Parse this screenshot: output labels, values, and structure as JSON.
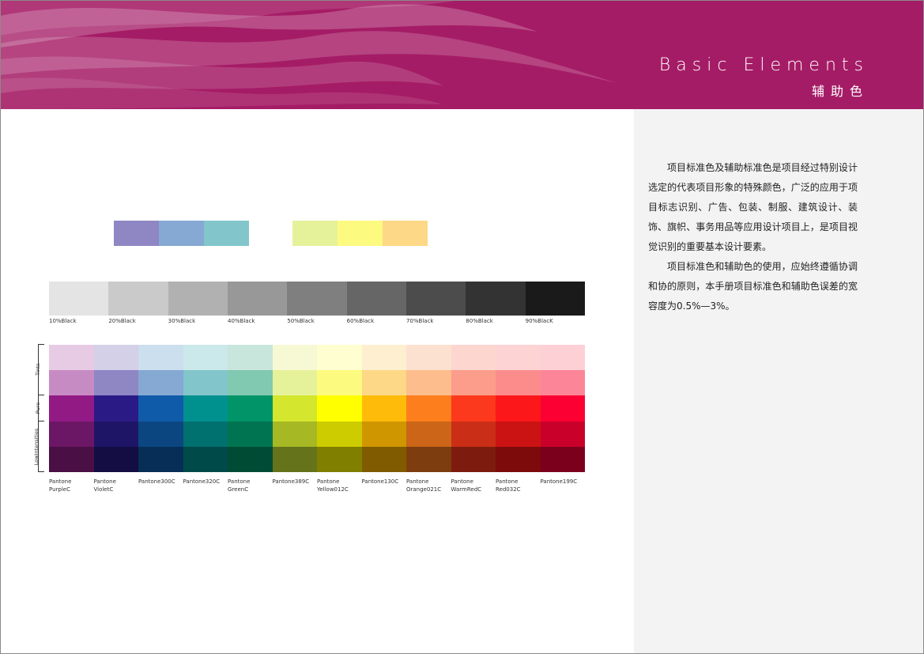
{
  "header": {
    "title_en": "Basic Elements",
    "title_zh": "辅助色",
    "color": "#a51c66"
  },
  "description": {
    "paragraphs": [
      "项目标准色及辅助标准色是项目经过特别设计选定的代表项目形象的特殊颜色，广泛的应用于项目标志识别、广告、包装、制服、建筑设计、装饰、旗帜、事务用品等应用设计项目上，是项目视觉识别的重要基本设计要素。",
      "项目标准色和辅助色的使用，应始终遵循协调和协的原则，本手册项目标准色和辅助色误差的宽容度为0.5%—3%。"
    ]
  },
  "accent_swatches": {
    "cool": [
      "#8e87c4",
      "#86a9d3",
      "#82c6cb"
    ],
    "warm": [
      "#e6f29a",
      "#fdfa80",
      "#fdd886"
    ]
  },
  "gray_scale": {
    "colors": [
      "#e4e4e4",
      "#cacaca",
      "#b1b1b1",
      "#989898",
      "#7f7f7f",
      "#666666",
      "#4c4c4c",
      "#333333",
      "#1a1a1a"
    ],
    "labels": [
      "10%Black",
      "20%Black",
      "30%Black",
      "40%Black",
      "50%Black",
      "60%Black",
      "70%Black",
      "80%Black",
      "90%BlacK"
    ]
  },
  "color_matrix": {
    "group_labels": [
      "Tints",
      "Pure",
      "LowIntensities"
    ],
    "rows": [
      [
        "#e7cbe4",
        "#d3d0e8",
        "#ccdfee",
        "#cbe8ea",
        "#c9e6dd",
        "#f6f9d3",
        "#fefed0",
        "#fdefcf",
        "#fde1d0",
        "#fdd6d0",
        "#fdd3d3",
        "#fdd0d6"
      ],
      [
        "#c78bc4",
        "#8e87c4",
        "#86a9d3",
        "#82c6cb",
        "#81c9b1",
        "#e6f29a",
        "#fdfa80",
        "#fdd886",
        "#fdbd8c",
        "#fc9c8a",
        "#fc8c8c",
        "#fc8598"
      ],
      [
        "#921a85",
        "#2a1a86",
        "#0f5baa",
        "#00918f",
        "#019468",
        "#d4e62d",
        "#ffff00",
        "#ffbb0a",
        "#fd7e1c",
        "#fc391c",
        "#fc171b",
        "#fc0033"
      ],
      [
        "#6c1765",
        "#1f1567",
        "#0b4681",
        "#00716f",
        "#007450",
        "#a6b824",
        "#cdcc00",
        "#cf9600",
        "#cc6517",
        "#cb2e17",
        "#cb1313",
        "#c8002a"
      ],
      [
        "#4a0f45",
        "#140d44",
        "#062e56",
        "#004a49",
        "#004b34",
        "#65731a",
        "#817f00",
        "#805b00",
        "#7e3d0f",
        "#7d1c0e",
        "#7d0b0b",
        "#7b001b"
      ]
    ]
  },
  "pantone_labels": [
    "Pantone\nPurpleC",
    "Pantone\nVioletC",
    "Pantone300C",
    "Pantone320C",
    "Pantone\nGreenC",
    "Pantone389C",
    "Pantone\nYellow012C",
    "Pantone130C",
    "Pantone\nOrange021C",
    "Pantone\nWarmRedC",
    "Pantone\nRed032C",
    "Pantone199C"
  ]
}
